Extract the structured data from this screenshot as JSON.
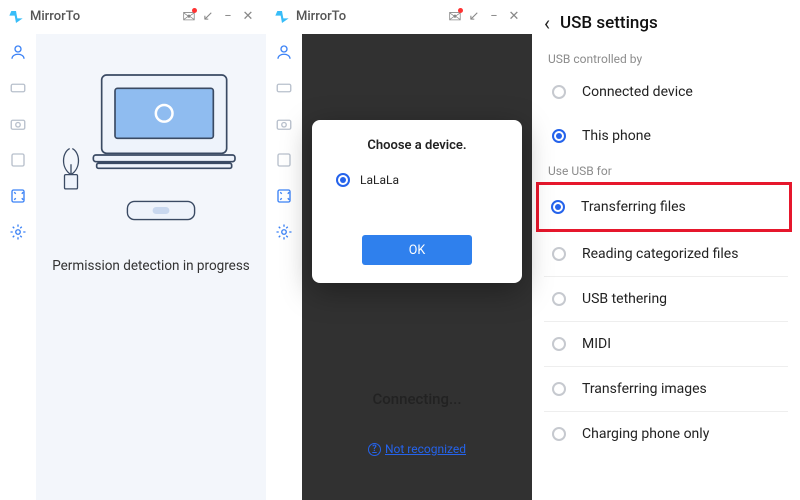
{
  "app": {
    "name": "MirrorTo"
  },
  "panel1": {
    "status": "Permission detection in progress"
  },
  "panel2": {
    "modal_title": "Choose a device.",
    "device": "LaLaLa",
    "ok": "OK",
    "connecting": "Connecting...",
    "not_recognized": "Not recognized"
  },
  "panel3": {
    "title": "USB settings",
    "section1": "USB controlled by",
    "opt_connected_device": "Connected device",
    "opt_this_phone": "This phone",
    "section2": "Use USB for",
    "opt_transfer_files": "Transferring files",
    "opt_read_cat": "Reading categorized files",
    "opt_tether": "USB tethering",
    "opt_midi": "MIDI",
    "opt_images": "Transferring images",
    "opt_charge": "Charging phone only"
  }
}
